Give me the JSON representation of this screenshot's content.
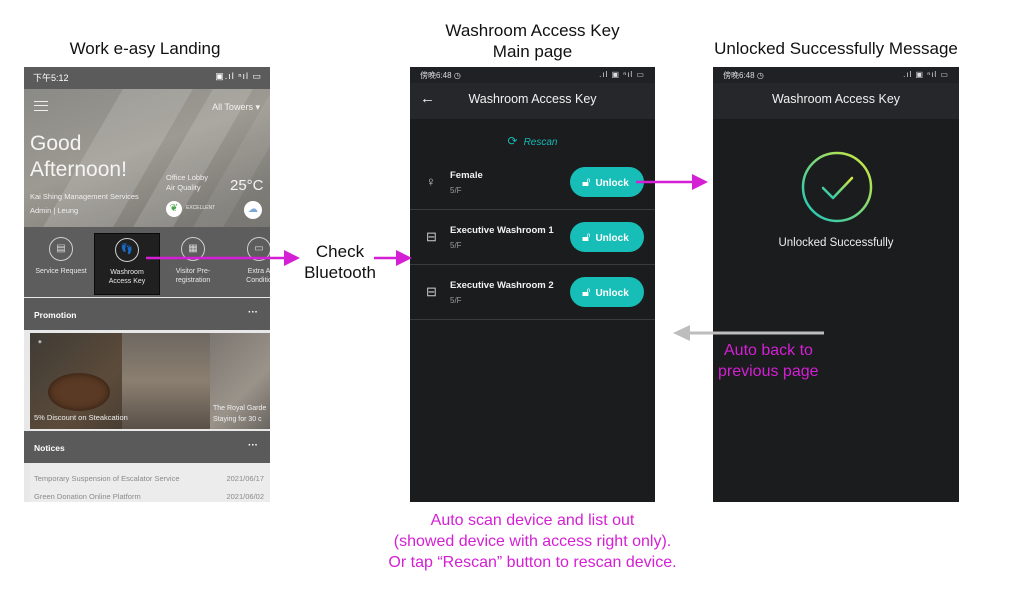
{
  "labels": {
    "landing_caption": "Work e-asy Landing",
    "main_caption_line1": "Washroom Access Key",
    "main_caption_line2": "Main page",
    "success_caption": "Unlocked Successfully Message",
    "check_bluetooth_line1": "Check",
    "check_bluetooth_line2": "Bluetooth",
    "auto_back_line1": "Auto back to",
    "auto_back_line2": "previous page",
    "auto_scan_line1": "Auto scan device and list out",
    "auto_scan_line2": "(showed device with access right only).",
    "auto_scan_line3": "Or tap “Rescan” button to rescan device."
  },
  "colors": {
    "annotation": "#d41fd4",
    "teal": "#17bdb7",
    "return_arrow": "#bdbdbd"
  },
  "landing": {
    "status_time": "下午5:12",
    "tower_filter": "All Towers",
    "greeting_line1": "Good",
    "greeting_line2": "Afternoon!",
    "company": "Kai Shing Management Services",
    "user": "Admin | Leung",
    "air_quality_line1": "Office Lobby",
    "air_quality_line2": "Air Quality",
    "air_quality_status": "EXCELLENT",
    "temperature": "25°C",
    "quick_actions": [
      {
        "line1": "Service Request",
        "line2": "",
        "icon": "service-icon"
      },
      {
        "line1": "Washroom",
        "line2": "Access Key",
        "icon": "footprint-icon"
      },
      {
        "line1": "Visitor Pre-",
        "line2": "registration",
        "icon": "visitor-icon"
      },
      {
        "line1": "Extra A",
        "line2": "Conditio",
        "icon": "ac-icon"
      }
    ],
    "promotion_title": "Promotion",
    "promo_1_caption": "5% Discount on Steakcation",
    "promo_2_caption_line1": "The Royal Garde",
    "promo_2_caption_line2": "Staying for 30 c",
    "notices_title": "Notices",
    "more": "···",
    "notices": [
      {
        "title": "Temporary Suspension of Escalator Service",
        "date": "2021/06/17"
      },
      {
        "title": "Green Donation Online Platform",
        "date": "2021/06/02"
      }
    ]
  },
  "main_page": {
    "status_time": "傍晚6:48",
    "title": "Washroom Access Key",
    "rescan_label": "Rescan",
    "unlock_label": "Unlock",
    "devices": [
      {
        "name": "Female",
        "floor": "5/F",
        "icon": "female-icon"
      },
      {
        "name": "Executive Washroom 1",
        "floor": "5/F",
        "icon": "briefcase-icon"
      },
      {
        "name": "Executive Washroom 2",
        "floor": "5/F",
        "icon": "briefcase-icon"
      }
    ]
  },
  "success_page": {
    "status_time": "傍晚6:48",
    "title": "Washroom Access Key",
    "message": "Unlocked Successfully"
  }
}
